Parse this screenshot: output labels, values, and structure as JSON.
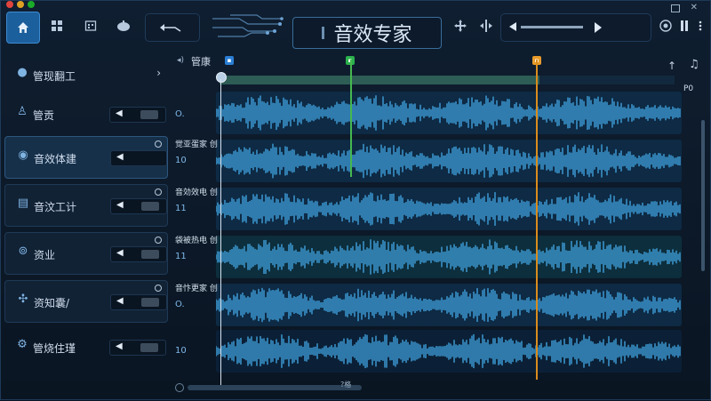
{
  "window": {
    "title": "音效专家"
  },
  "colors": {
    "accent": "#2f86d6",
    "marker_blue": "#2a7fd4",
    "marker_green": "#2bb24c",
    "marker_orange": "#e89b2a",
    "playhead_orange": "#d98c1d",
    "playhead_green": "#45b84f"
  },
  "toolbar": {
    "icons": [
      "home-icon",
      "grid-icon",
      "calendar-icon",
      "bell-icon",
      "undo-icon",
      "circuit-icon",
      "move-icon",
      "split-icon",
      "play-icon",
      "settings-icon",
      "pause-icon"
    ]
  },
  "sidebar": {
    "items": [
      {
        "label": "管现翻工",
        "icon": "people-icon"
      },
      {
        "label": "管贡",
        "icon": "user-icon"
      },
      {
        "label": "音效体建",
        "icon": "shield-icon"
      },
      {
        "label": "音汶工计",
        "icon": "layout-icon"
      },
      {
        "label": "资业",
        "icon": "circle-arrow-icon"
      },
      {
        "label": "资知囊/",
        "icon": "network-icon"
      },
      {
        "label": "管烧住瑾",
        "icon": "gear-icon"
      }
    ]
  },
  "timeline": {
    "header_label": "管康",
    "marker_blue_label": "▪",
    "marker_green_label": "▪",
    "marker_orange_label": "▪",
    "ruler_end": "P0",
    "bottom_label": "?格",
    "tracks": [
      {
        "label": "",
        "num": "O."
      },
      {
        "label": "觉亚蛋家 创",
        "num": "10"
      },
      {
        "label": "音効效电 创",
        "num": "11"
      },
      {
        "label": "袋被热电 创",
        "num": "11"
      },
      {
        "label": "音忭更家 创",
        "num": "O."
      },
      {
        "label": "",
        "num": "10"
      }
    ]
  }
}
